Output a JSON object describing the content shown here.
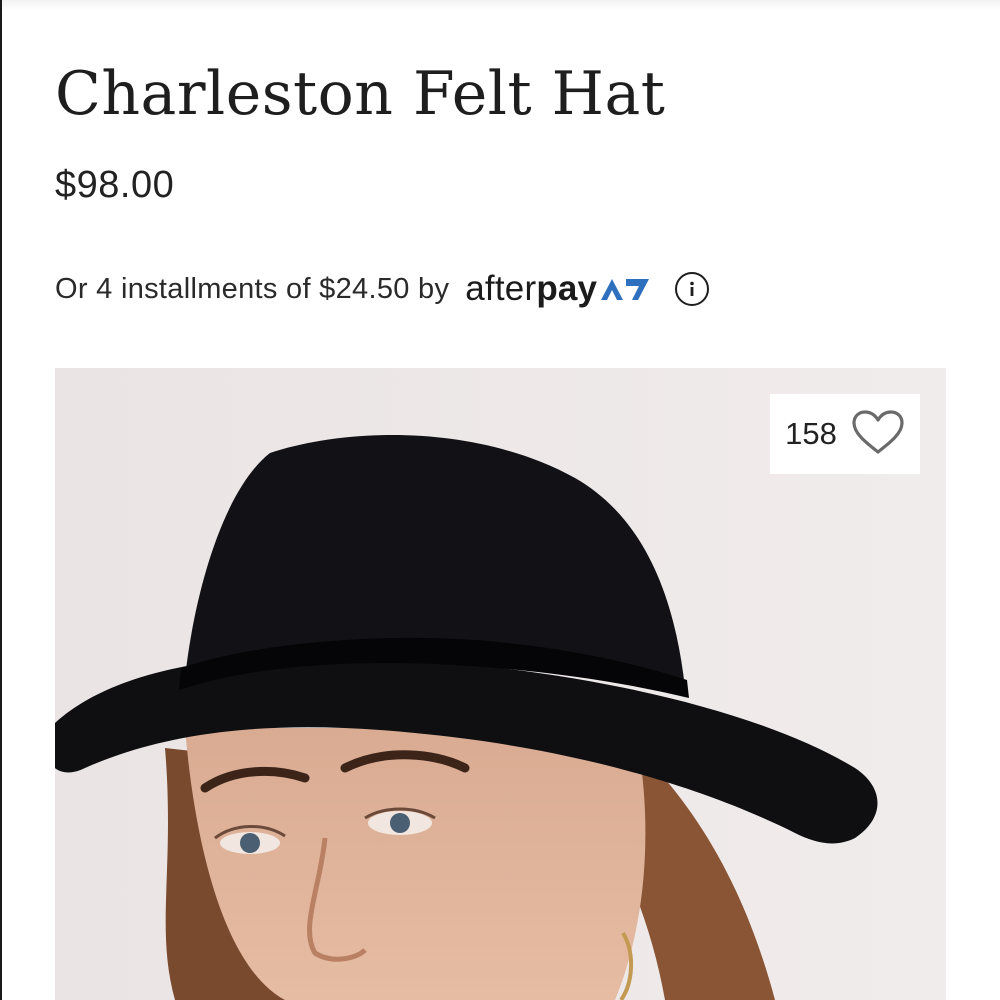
{
  "product": {
    "title": "Charleston Felt Hat",
    "price": "$98.00"
  },
  "afterpay": {
    "installment_text": "Or 4 installments of $24.50 by",
    "logo_after": "after",
    "logo_pay": "pay"
  },
  "likes": {
    "count": "158"
  },
  "icons": {
    "info": "info-circle-icon",
    "heart": "heart-outline-icon",
    "afterpay_mark": "afterpay-arrows-icon"
  },
  "colors": {
    "afterpay_mark": "#2e6fbe",
    "image_background": "#ece6e6",
    "hat": "#0f0f12"
  }
}
